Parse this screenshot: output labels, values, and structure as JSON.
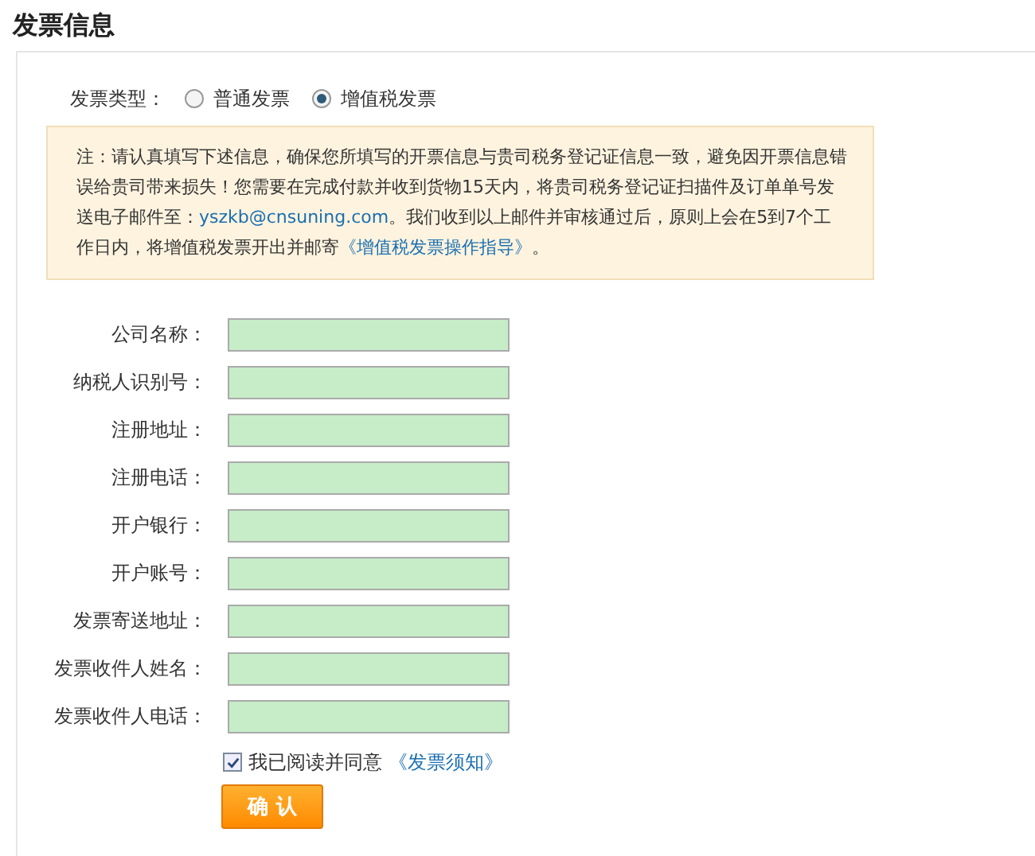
{
  "title": "发票信息",
  "invoice_type": {
    "label": "发票类型：",
    "options": [
      {
        "label": "普通发票",
        "selected": false
      },
      {
        "label": "增值税发票",
        "selected": true
      }
    ]
  },
  "notice": {
    "parts": [
      {
        "kind": "text",
        "text": "注：请认真填写下述信息，确保您所填写的开票信息与贵司税务登记证信息一致，避免因开票信息错误给贵司带来损失！您需要在完成付款并收到货物15天内，将贵司税务登记证扫描件及订单单号发送电子邮件至："
      },
      {
        "kind": "link",
        "text": "yszkb@cnsuning.com"
      },
      {
        "kind": "text",
        "text": "。我们收到以上邮件并审核通过后，原则上会在5到7个工作日内，将增值税发票开出并邮寄"
      },
      {
        "kind": "link",
        "text": "《增值税发票操作指导》"
      },
      {
        "kind": "text",
        "text": "。"
      }
    ]
  },
  "fields": [
    {
      "label": "公司名称："
    },
    {
      "label": "纳税人识别号："
    },
    {
      "label": "注册地址："
    },
    {
      "label": "注册电话："
    },
    {
      "label": "开户银行："
    },
    {
      "label": "开户账号："
    },
    {
      "label": "发票寄送地址："
    },
    {
      "label": "发票收件人姓名："
    },
    {
      "label": "发票收件人电话："
    }
  ],
  "agreement": {
    "checked": true,
    "text": "我已阅读并同意",
    "link": "《发票须知》"
  },
  "submit": "确 认"
}
